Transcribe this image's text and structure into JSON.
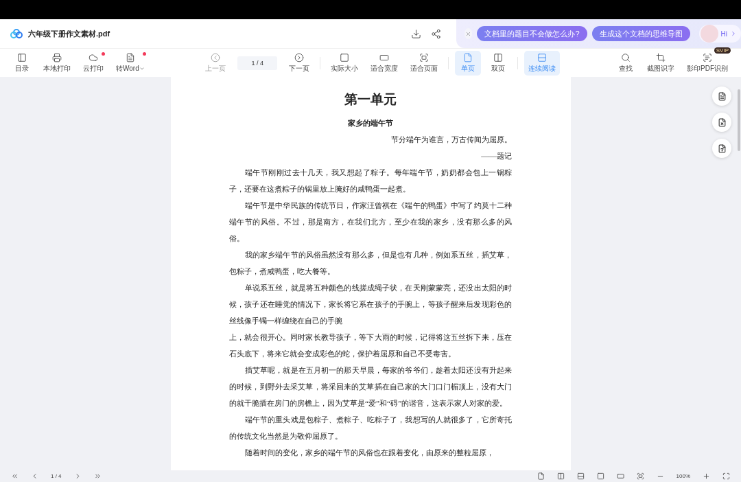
{
  "header": {
    "file_name": "六年级下册作文素材.pdf",
    "ai_chips": [
      "文档里的题目不会做怎么办?",
      "生成这个文档的思维导图"
    ],
    "greeting": "Hi"
  },
  "toolbar": {
    "left": [
      {
        "label": "目录"
      },
      {
        "label": "本地打印"
      },
      {
        "label": "云打印",
        "dot": true
      },
      {
        "label": "转Word",
        "dot": true,
        "caret": true
      }
    ],
    "prev": {
      "label": "上一页",
      "disabled": true
    },
    "page": "1 / 4",
    "next": {
      "label": "下一页",
      "disabled": false
    },
    "fit": [
      {
        "label": "实际大小"
      },
      {
        "label": "适合宽度"
      },
      {
        "label": "适合页面"
      }
    ],
    "layout": [
      {
        "label": "单页",
        "selected": true
      },
      {
        "label": "双页",
        "selected": false
      }
    ],
    "continuous": {
      "label": "连续阅读",
      "selected": true
    },
    "right": [
      {
        "label": "查找"
      },
      {
        "label": "截图识字"
      },
      {
        "label": "影印PDF识别",
        "badge": "SVIP"
      }
    ]
  },
  "document": {
    "title": "第一单元",
    "subtitle": "家乡的端午节",
    "epigraph": "节分端午为谁言，万古传闻为屈原。",
    "attribution": "——题记",
    "paragraphs": [
      {
        "text": "端午节刚刚过去十几天，我又想起了粽子。每年端午节，奶奶都会包上一锅粽子，还要在这煮粽子的锅里放上腌好的咸鸭蛋一起煮。",
        "indent": true
      },
      {
        "text": "端午节是中华民族的传统节日，作家汪曾祺在《端午的鸭蛋》中写了约莫十二种端午节的风俗。不过，那是南方，在我们北方，至少在我的家乡，没有那么多的风俗。",
        "indent": true
      },
      {
        "text": "我的家乡端午节的风俗虽然没有那么多，但是也有几种，例如系五丝，插艾草，包粽子，煮咸鸭蛋，吃大餐等。",
        "indent": true
      },
      {
        "text": "单说系五丝，就是将五种颜色的线搓成绳子状，在天刚蒙蒙亮，还没出太阳的时候，孩子还在睡觉的情况下，家长将它系在孩子的手腕上，等孩子醒来后发现彩色的丝线像手镯一样缠绕在自己的手腕",
        "indent": true
      },
      {
        "text": "上，就会很开心。同时家长教导孩子，等下大雨的时候，记得将这五丝拆下来，压在石头底下，将来它就会变成彩色的蛇，保护着屈原和自己不受毒害。",
        "indent": false
      },
      {
        "text": "插艾草呢，就是在五月初一的那天早晨，每家的爷爷们，趁着太阳还没有升起来的时候，到野外去采艾草，将采回来的艾草插在自己家的大门口门楣顶上，没有大门的就干脆插在房门的房檐上，因为艾草是“爱”和“碍”的谐音，这表示家人对家的爱。",
        "indent": true
      },
      {
        "text": "端午节的重头戏是包粽子、煮粽子、吃粽子了，我想写的人就很多了，它所寄托的传统文化当然是为敬仰屈原了。",
        "indent": true
      },
      {
        "text": "随着时间的变化，家乡的端午节的风俗也在跟着变化，由原来的整粒屈原，",
        "indent": true
      }
    ]
  },
  "status_bar": {
    "page": "1 / 4",
    "zoom": "100%"
  }
}
